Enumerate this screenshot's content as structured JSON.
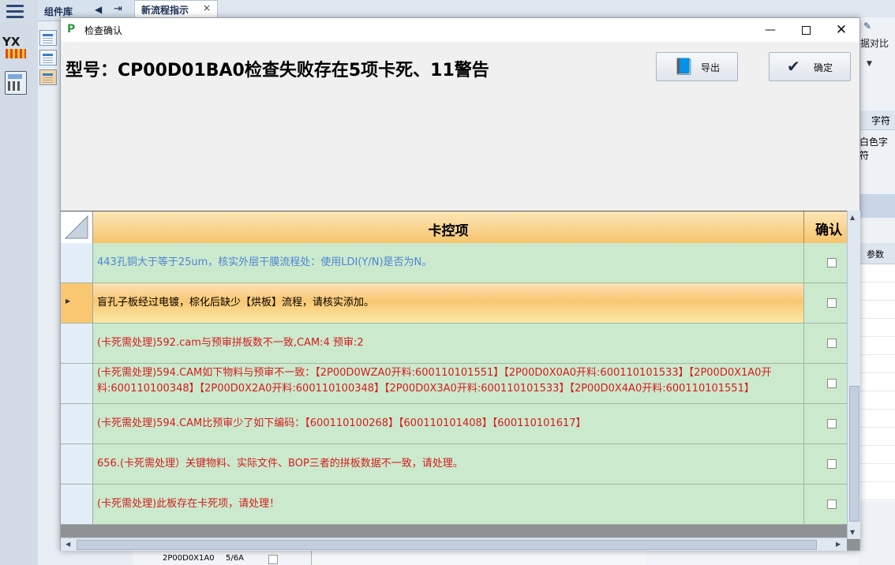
{
  "background": {
    "library": {
      "title": "组件库"
    },
    "tab": {
      "label": "新流程指示",
      "close": "×"
    },
    "right_panel": {
      "button_label": "据对比",
      "header1": "字符",
      "row1": "白色字符",
      "header2": "参数"
    },
    "bottom_strip": {
      "cell1": "2P00D0X1A0",
      "cell2": "5/6A"
    }
  },
  "dialog": {
    "title": "检查确认",
    "heading": "型号：CP00D01BA0检查失败存在5项卡死、11警告",
    "export_label": "导出",
    "ok_label": "确定"
  },
  "grid": {
    "columns": {
      "main": "卡控项",
      "confirm": "确认"
    },
    "rows": [
      {
        "text": "443孔铜大于等于25um，核实外层干膜流程处：使用LDI(Y/N)是否为N。",
        "color": "#4d86d4",
        "confirmed": false
      },
      {
        "text": "盲孔子板经过电镀，棕化后缺少【烘板】流程，请核实添加。",
        "color": "#000000",
        "confirmed": false
      },
      {
        "text": "(卡死需处理)592.cam与预审拼板数不一致,CAM:4 预审:2",
        "color": "#d61c1c",
        "confirmed": false
      },
      {
        "text": "(卡死需处理)594.CAM如下物料与预审不一致：【2P00D0WZA0开料:600110101551】【2P00D0X0A0开料:600110101533】【2P00D0X1A0开料:600110100348】【2P00D0X2A0开料:600110100348】【2P00D0X3A0开料:600110101533】【2P00D0X4A0开料:600110101551】",
        "color": "#d61c1c",
        "confirmed": false
      },
      {
        "text": "(卡死需处理)594.CAM比预审少了如下编码：【600110100268】【600110101408】【600110101617】",
        "color": "#d61c1c",
        "confirmed": false
      },
      {
        "text": "656.(卡死需处理）关键物料、实际文件、BOP三者的拼板数据不一致，请处理。",
        "color": "#d61c1c",
        "confirmed": false
      },
      {
        "text": "(卡死需处理)此板存在卡死项，请处理！",
        "color": "#d61c1c",
        "confirmed": false
      }
    ]
  }
}
